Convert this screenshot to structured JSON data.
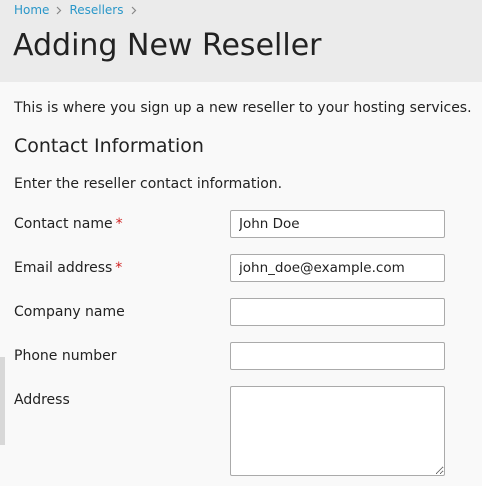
{
  "breadcrumb": {
    "items": [
      "Home",
      "Resellers"
    ]
  },
  "page": {
    "title": "Adding New Reseller",
    "intro": "This is where you sign up a new reseller to your hosting services."
  },
  "section": {
    "title": "Contact Information",
    "description": "Enter the reseller contact information."
  },
  "form": {
    "required_mark": "*",
    "contact_name": {
      "label": "Contact name",
      "value": "John Doe",
      "required": true
    },
    "email": {
      "label": "Email address",
      "value": "john_doe@example.com",
      "required": true
    },
    "company": {
      "label": "Company name",
      "value": ""
    },
    "phone": {
      "label": "Phone number",
      "value": ""
    },
    "address": {
      "label": "Address",
      "value": ""
    }
  },
  "icons": {
    "breadcrumb_separator": "chevron-right-icon",
    "textarea_resize": "resize-grip-icon"
  },
  "colors": {
    "link": "#2a97c9",
    "required": "#d02020",
    "header_bg": "#ebebeb",
    "page_bg": "#f9f9f9"
  }
}
